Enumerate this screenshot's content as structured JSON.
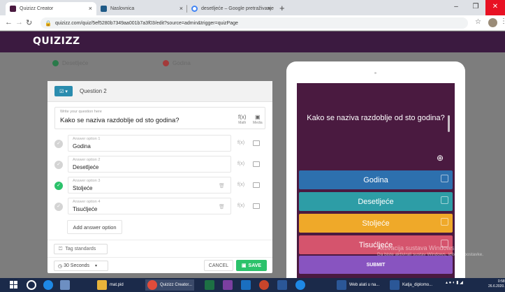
{
  "browser": {
    "tabs": [
      {
        "title": "Quizizz Creator",
        "favicon_color": "#4a1a40",
        "active": true
      },
      {
        "title": "Naslovnica",
        "favicon_color": "#1f5a87",
        "active": false
      },
      {
        "title": "desetljeće – Google pretraživanje",
        "favicon_color": "#4285f4",
        "active": false
      }
    ],
    "new_tab": "+",
    "close_glyph": "×",
    "url": "quizizz.com/quiz/5ef5280b7349aa001b7a3f03/edit?source=admin&trigger=quizPage",
    "window_controls": {
      "minimize": "–",
      "maximize": "❐",
      "close": "✕"
    }
  },
  "app": {
    "logo": "QUIZIZZ",
    "background_options": [
      {
        "label": "Desetljeće",
        "color": "#2a7a4a"
      },
      {
        "label": "Godina",
        "color": "#a33a3a"
      }
    ]
  },
  "editor": {
    "question_label": "Question 2",
    "question_placeholder": "Write your question here",
    "question_text": "Kako se naziva razdoblje od sto godina?",
    "tools": {
      "math_label": "Math",
      "media_label": "Media",
      "math_glyph": "f(x)"
    },
    "answers": [
      {
        "placeholder": "Answer option 1",
        "value": "Godina",
        "correct": false
      },
      {
        "placeholder": "Answer option 2",
        "value": "Desetljeće",
        "correct": false
      },
      {
        "placeholder": "Answer option 3",
        "value": "Stoljeće",
        "correct": true
      },
      {
        "placeholder": "Answer option 4",
        "value": "Tisućljeće",
        "correct": false
      }
    ],
    "add_answer": "Add answer option",
    "tag_standards": "Tag standards",
    "timer": "30 Seconds",
    "cancel": "CANCEL",
    "save": "SAVE"
  },
  "preview": {
    "question_text": "Kako se naziva razdoblje od sto godina?",
    "options": [
      {
        "label": "Godina",
        "color": "#2d70ae"
      },
      {
        "label": "Desetljeće",
        "color": "#2d9da6"
      },
      {
        "label": "Stoljeće",
        "color": "#efa929"
      },
      {
        "label": "Tisućljeće",
        "color": "#d5546d"
      }
    ],
    "submit": "SUBMIT"
  },
  "watermark": {
    "line1": "Aktivacija sustava Windows",
    "line2": "Da biste aktivirali sustav Windows, idite na postavke."
  },
  "taskbar": {
    "apps": [
      {
        "label": "mat.pid",
        "color": "#e8b33a"
      },
      {
        "label": "Quizizz Creator...",
        "color": "#e24c3b"
      },
      {
        "label": "Web alati u na...",
        "color": "#2b5797"
      },
      {
        "label": "Katja_diplomo...",
        "color": "#2b5797"
      }
    ],
    "clock_time": "0:58",
    "clock_date": "26.6.2020."
  },
  "colors": {
    "accent": "#8854c0",
    "header": "#3b1a40",
    "correct": "#2cc26b"
  }
}
